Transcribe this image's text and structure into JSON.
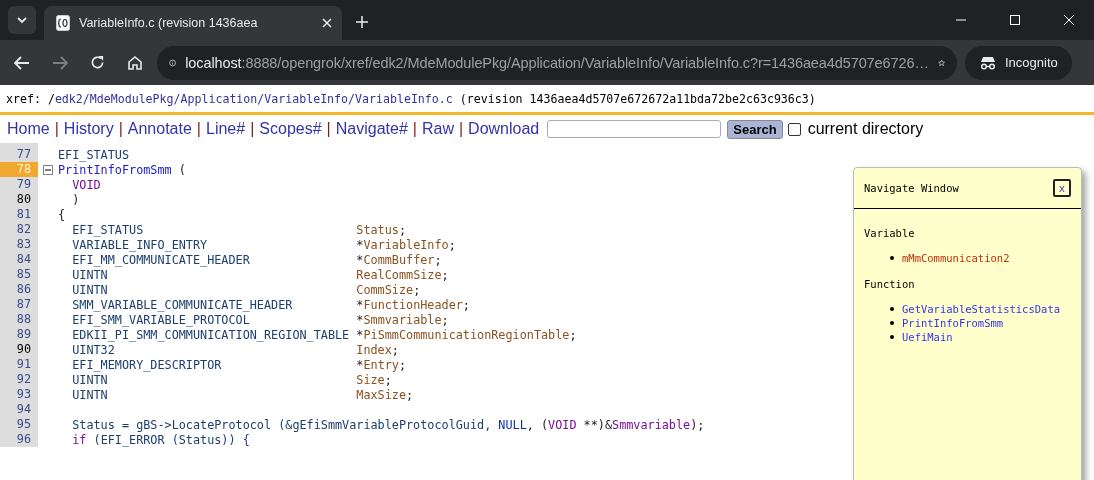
{
  "browser": {
    "tab_title": "VariableInfo.c (revision 1436aea",
    "url_host": "localhost",
    "url_rest": ":8888/opengrok/xref/edk2/MdeModulePkg/Application/VariableInfo/VariableInfo.c?r=1436aea4d5707e6726…",
    "profile": "Incognito"
  },
  "breadcrumb": {
    "prefix": "xref: /",
    "separator": "/",
    "parts": [
      "edk2",
      "MdeModulePkg",
      "Application",
      "VariableInfo",
      "VariableInfo.c"
    ],
    "revision": "(revision 1436aea4d5707e672672a11bda72be2c63c936c3)"
  },
  "menu_separator": "|",
  "menu": [
    "Home",
    "History",
    "Annotate",
    "Line#",
    "Scopes#",
    "Navigate#",
    "Raw",
    "Download"
  ],
  "search": {
    "button": "Search",
    "checkbox_label": "current directory",
    "checked": false
  },
  "code": [
    {
      "num": "77",
      "selected": false,
      "bold": false,
      "fold": false,
      "segments": [
        {
          "text": "EFI_STATUS",
          "kind": "type"
        }
      ]
    },
    {
      "num": "78",
      "selected": true,
      "bold": false,
      "fold": true,
      "segments": [
        {
          "text": "PrintInfoFromSmm",
          "kind": "func"
        },
        {
          "text": " (",
          "kind": "plain"
        }
      ]
    },
    {
      "num": "79",
      "selected": false,
      "bold": false,
      "fold": false,
      "segments": [
        {
          "text": "  VOID",
          "kind": "keyword"
        }
      ]
    },
    {
      "num": "80",
      "selected": false,
      "bold": true,
      "fold": false,
      "segments": [
        {
          "text": "  )",
          "kind": "plain"
        }
      ]
    },
    {
      "num": "81",
      "selected": false,
      "bold": false,
      "fold": false,
      "segments": [
        {
          "text": "{",
          "kind": "plain"
        }
      ]
    },
    {
      "num": "82",
      "selected": false,
      "bold": false,
      "fold": false,
      "segments": [
        {
          "text": "  EFI_STATUS                              ",
          "kind": "type"
        },
        {
          "text": "Status",
          "kind": "var"
        },
        {
          "text": ";",
          "kind": "plain"
        }
      ]
    },
    {
      "num": "83",
      "selected": false,
      "bold": false,
      "fold": false,
      "segments": [
        {
          "text": "  VARIABLE_INFO_ENTRY                     ",
          "kind": "type"
        },
        {
          "text": "*",
          "kind": "plain"
        },
        {
          "text": "VariableInfo",
          "kind": "var"
        },
        {
          "text": ";",
          "kind": "plain"
        }
      ]
    },
    {
      "num": "84",
      "selected": false,
      "bold": false,
      "fold": false,
      "segments": [
        {
          "text": "  EFI_MM_COMMUNICATE_HEADER               ",
          "kind": "type"
        },
        {
          "text": "*",
          "kind": "plain"
        },
        {
          "text": "CommBuffer",
          "kind": "var"
        },
        {
          "text": ";",
          "kind": "plain"
        }
      ]
    },
    {
      "num": "85",
      "selected": false,
      "bold": false,
      "fold": false,
      "segments": [
        {
          "text": "  UINTN                                   ",
          "kind": "type"
        },
        {
          "text": "RealCommSize",
          "kind": "var"
        },
        {
          "text": ";",
          "kind": "plain"
        }
      ]
    },
    {
      "num": "86",
      "selected": false,
      "bold": false,
      "fold": false,
      "segments": [
        {
          "text": "  UINTN                                   ",
          "kind": "type"
        },
        {
          "text": "CommSize",
          "kind": "var"
        },
        {
          "text": ";",
          "kind": "plain"
        }
      ]
    },
    {
      "num": "87",
      "selected": false,
      "bold": false,
      "fold": false,
      "segments": [
        {
          "text": "  SMM_VARIABLE_COMMUNICATE_HEADER         ",
          "kind": "type"
        },
        {
          "text": "*",
          "kind": "plain"
        },
        {
          "text": "FunctionHeader",
          "kind": "var"
        },
        {
          "text": ";",
          "kind": "plain"
        }
      ]
    },
    {
      "num": "88",
      "selected": false,
      "bold": false,
      "fold": false,
      "segments": [
        {
          "text": "  EFI_SMM_VARIABLE_PROTOCOL               ",
          "kind": "type"
        },
        {
          "text": "*",
          "kind": "plain"
        },
        {
          "text": "Smmvariable",
          "kind": "var"
        },
        {
          "text": ";",
          "kind": "plain"
        }
      ]
    },
    {
      "num": "89",
      "selected": false,
      "bold": false,
      "fold": false,
      "segments": [
        {
          "text": "  EDKII_PI_SMM_COMMUNICATION_REGION_TABLE ",
          "kind": "type"
        },
        {
          "text": "*",
          "kind": "plain"
        },
        {
          "text": "PiSmmCommunicationRegionTable",
          "kind": "var"
        },
        {
          "text": ";",
          "kind": "plain"
        }
      ]
    },
    {
      "num": "90",
      "selected": false,
      "bold": true,
      "fold": false,
      "segments": [
        {
          "text": "  UINT32                                  ",
          "kind": "type"
        },
        {
          "text": "Index",
          "kind": "var"
        },
        {
          "text": ";",
          "kind": "plain"
        }
      ]
    },
    {
      "num": "91",
      "selected": false,
      "bold": false,
      "fold": false,
      "segments": [
        {
          "text": "  EFI_MEMORY_DESCRIPTOR                   ",
          "kind": "type"
        },
        {
          "text": "*",
          "kind": "plain"
        },
        {
          "text": "Entry",
          "kind": "var"
        },
        {
          "text": ";",
          "kind": "plain"
        }
      ]
    },
    {
      "num": "92",
      "selected": false,
      "bold": false,
      "fold": false,
      "segments": [
        {
          "text": "  UINTN                                   ",
          "kind": "type"
        },
        {
          "text": "Size",
          "kind": "var"
        },
        {
          "text": ";",
          "kind": "plain"
        }
      ]
    },
    {
      "num": "93",
      "selected": false,
      "bold": false,
      "fold": false,
      "segments": [
        {
          "text": "  UINTN                                   ",
          "kind": "type"
        },
        {
          "text": "MaxSize",
          "kind": "var"
        },
        {
          "text": ";",
          "kind": "plain"
        }
      ]
    },
    {
      "num": "94",
      "selected": false,
      "bold": false,
      "fold": false
    },
    {
      "num": "95",
      "selected": false,
      "bold": false,
      "fold": false,
      "segments": [
        {
          "text": "  Status = gBS->LocateProtocol (&gEfiSmmVariableProtocolGuid, ",
          "kind": "type"
        },
        {
          "text": "NULL",
          "kind": "macro"
        },
        {
          "text": ", (",
          "kind": "plain"
        },
        {
          "text": "VOID",
          "kind": "keyword"
        },
        {
          "text": " **)&",
          "kind": "plain"
        },
        {
          "text": "Smmvariable",
          "kind": "keyword"
        },
        {
          "text": ");",
          "kind": "plain"
        }
      ]
    },
    {
      "num": "96",
      "selected": false,
      "bold": false,
      "fold": false,
      "segments": [
        {
          "text": "  if",
          "kind": "keyword"
        },
        {
          "text": " (EFI_ERROR (Status)) {",
          "kind": "type"
        }
      ]
    }
  ],
  "navigate_window": {
    "title": "Navigate Window",
    "close": "x",
    "sections": [
      {
        "heading": "Variable",
        "kind": "variable",
        "items": [
          "mMmCommunication2"
        ]
      },
      {
        "heading": "Function",
        "kind": "function",
        "items": [
          "GetVariableStatisticsData",
          "PrintInfoFromSmm",
          "UefiMain"
        ]
      }
    ]
  }
}
